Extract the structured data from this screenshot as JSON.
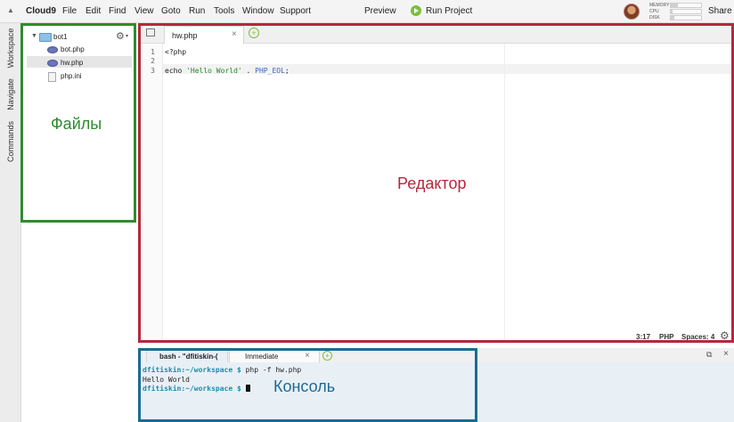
{
  "menubar": {
    "brand": "Cloud9",
    "items": [
      "File",
      "Edit",
      "Find",
      "View",
      "Goto",
      "Run",
      "Tools",
      "Window",
      "Support"
    ],
    "preview": "Preview",
    "run_project": "Run Project",
    "share": "Share",
    "meters": [
      "MEMORY",
      "CPU",
      "DISK"
    ]
  },
  "side_tabs": [
    "Workspace",
    "Navigate",
    "Commands"
  ],
  "tree": {
    "root": "bot1",
    "files": [
      "bot.php",
      "hw.php",
      "php.ini"
    ]
  },
  "editor": {
    "tab_title": "hw.php",
    "close": "×",
    "add": "+",
    "line_numbers": [
      "1",
      "2",
      "3"
    ],
    "code": {
      "line1": "<?php",
      "line3_echo": "echo ",
      "line3_string": "'Hello World'",
      "line3_dot": " . ",
      "line3_const": "PHP_EOL",
      "line3_end": ";"
    },
    "status": {
      "position": "3:17",
      "language": "PHP",
      "spaces": "Spaces: 4"
    }
  },
  "console": {
    "tabs": [
      "bash - \"dfitiskin-(",
      "Immediate"
    ],
    "close": "×",
    "add": "+",
    "prompt": "dfitiskin:~/workspace $",
    "command": " php -f hw.php",
    "output": "Hello World",
    "prompt2": "dfitiskin:~/workspace $"
  },
  "annotations": {
    "files": "Файлы",
    "editor": "Редактор",
    "console": "Консоль"
  },
  "colors": {
    "files_box": "#2e8b2e",
    "editor_box": "#b5283d",
    "console_box": "#1d6a93"
  }
}
